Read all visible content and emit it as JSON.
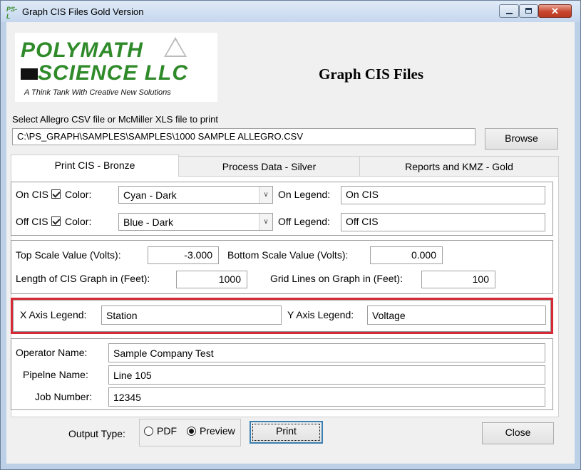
{
  "window": {
    "title": "Graph CIS Files Gold Version",
    "app_icon": "PS-L",
    "min_icon": "minimize-icon",
    "max_icon": "maximize-icon",
    "close_icon": "close-icon",
    "close_glyph": "✕"
  },
  "logo": {
    "line1": "POLYMATH",
    "line2": "SCIENCE LLC",
    "tagline": "A Think Tank With Creative New Solutions"
  },
  "heading": "Graph CIS Files",
  "file": {
    "prompt": "Select Allegro CSV file or McMiller XLS file to print",
    "path": "C:\\PS_GRAPH\\SAMPLES\\SAMPLES\\1000 SAMPLE ALLEGRO.CSV",
    "browse_label": "Browse"
  },
  "tabs": [
    {
      "label": "Print CIS - Bronze",
      "active": true
    },
    {
      "label": "Process Data - Silver",
      "active": false
    },
    {
      "label": "Reports and KMZ - Gold",
      "active": false
    }
  ],
  "on_cis": {
    "label": "On CIS",
    "checked": true,
    "color_label": "Color:",
    "color_value": "Cyan - Dark",
    "legend_label": "On Legend:",
    "legend_value": "On CIS"
  },
  "off_cis": {
    "label": "Off CIS",
    "checked": true,
    "color_label": "Color:",
    "color_value": "Blue - Dark",
    "legend_label": "Off Legend:",
    "legend_value": "Off CIS"
  },
  "scale": {
    "top_label": "Top Scale Value (Volts):",
    "top_value": "-3.000",
    "bottom_label": "Bottom Scale Value (Volts):",
    "bottom_value": "0.000",
    "length_label": "Length of CIS Graph in (Feet):",
    "length_value": "1000",
    "grid_label": "Grid Lines on Graph in (Feet):",
    "grid_value": "100"
  },
  "axis": {
    "x_label": "X Axis Legend:",
    "x_value": "Station",
    "y_label": "Y Axis Legend:",
    "y_value": "Voltage"
  },
  "info": {
    "operator_label": "Operator Name:",
    "operator_value": "Sample Company Test",
    "pipeline_label": "Pipelne Name:",
    "pipeline_value": "Line 105",
    "job_label": "Job Number:",
    "job_value": "12345"
  },
  "output": {
    "label": "Output Type:",
    "options": [
      "PDF",
      "Preview"
    ],
    "selected": "Preview"
  },
  "buttons": {
    "print": "Print",
    "close": "Close"
  },
  "colors": {
    "highlight_border": "#d62a36",
    "logo_green": "#2f8a2a"
  }
}
